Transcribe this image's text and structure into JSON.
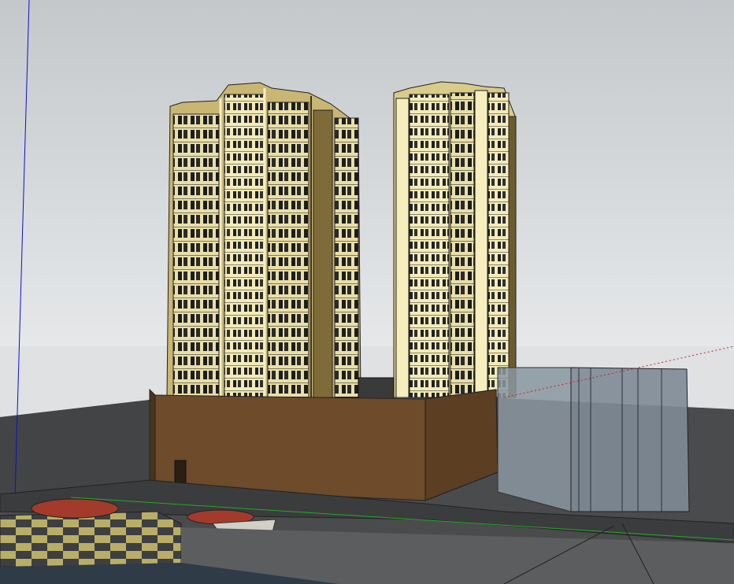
{
  "scene": {
    "description_text": "",
    "colors": {
      "sky_top": "#c6cacd",
      "sky_bottom": "#e4e6e8",
      "ground": "#4a4b4d",
      "ground_light": "#606163",
      "tower_face": "#f2e9b2",
      "tower_shadow": "#9a8548",
      "window_dark": "#1b1b1b",
      "podium_front": "#6c4a2b",
      "podium_side": "#5b3d22",
      "glass_block": "#8c98a3",
      "glass_block_2": "#7f8b95",
      "axis_blue": "#0000cc",
      "axis_green": "#00aa00",
      "axis_red": "#cc0000"
    },
    "icons": {
      "blue_axis": "axis-blue-icon",
      "green_axis": "axis-green-icon",
      "red_axis": "axis-red-icon"
    }
  }
}
